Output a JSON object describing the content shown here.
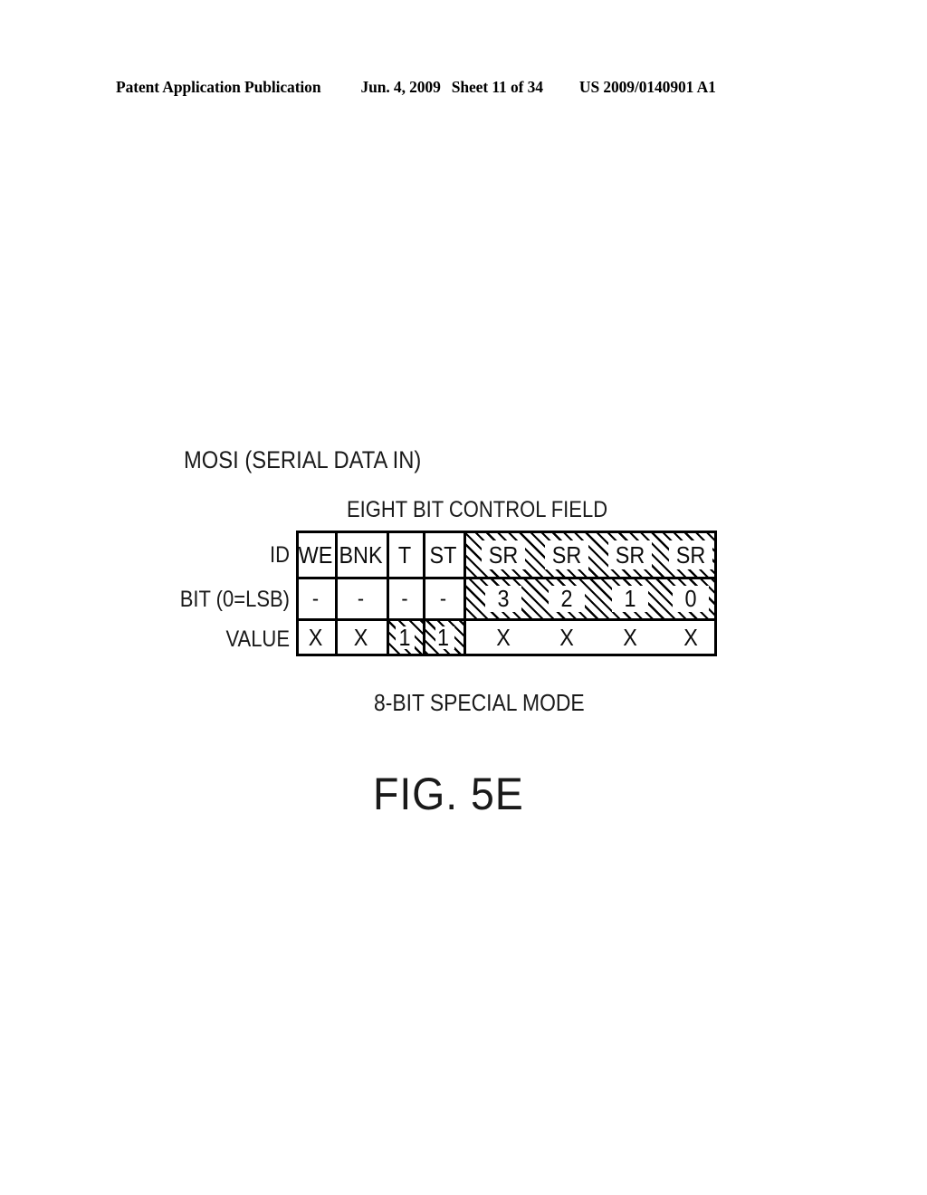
{
  "header": {
    "publication": "Patent Application Publication",
    "date": "Jun. 4, 2009",
    "sheet": "Sheet 11 of 34",
    "doc_number": "US 2009/0140901 A1"
  },
  "figure": {
    "signal_label": "MOSI (SERIAL DATA IN)",
    "field_title": "EIGHT BIT CONTROL FIELD",
    "mode_caption": "8-BIT SPECIAL MODE",
    "fig_number": "FIG. 5E",
    "row_labels": {
      "id": "ID",
      "bit": "BIT (0=LSB)",
      "value": "VALUE"
    },
    "table": {
      "columns": [
        {
          "id": "WE",
          "bit": "-",
          "value": "X"
        },
        {
          "id": "BNK",
          "bit": "-",
          "value": "X"
        },
        {
          "id": "T",
          "bit": "-",
          "value": "1"
        },
        {
          "id": "ST",
          "bit": "-",
          "value": "1"
        },
        {
          "id": "SR",
          "bit": "3",
          "value": "X"
        },
        {
          "id": "SR",
          "bit": "2",
          "value": "X"
        },
        {
          "id": "SR",
          "bit": "1",
          "value": "X"
        },
        {
          "id": "SR",
          "bit": "0",
          "value": "X"
        }
      ]
    }
  },
  "colors": {
    "ink": "#000000",
    "paper": "#ffffff"
  }
}
